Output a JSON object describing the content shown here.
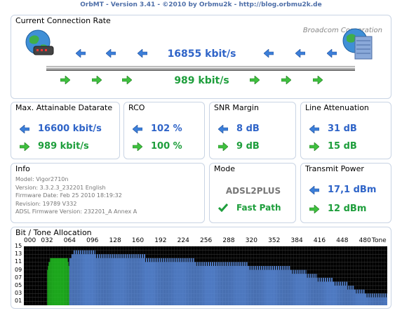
{
  "window": {
    "title": "OrbMT - Version 3.41 - ©2010 by Orbmu2k - http://blog.orbmu2k.de"
  },
  "connection": {
    "title": "Current Connection Rate",
    "isp": "Broadcom Corporation",
    "down_rate": "16855 kbit/s",
    "up_rate": "989 kbit/s"
  },
  "max_rate": {
    "title": "Max. Attainable Datarate",
    "down": "16600 kbit/s",
    "up": "989 kbit/s"
  },
  "rco": {
    "title": "RCO",
    "down": "102 %",
    "up": "100 %"
  },
  "snr": {
    "title": "SNR Margin",
    "down": "8 dB",
    "up": "9 dB"
  },
  "attenuation": {
    "title": "Line Attenuation",
    "down": "31 dB",
    "up": "15 dB"
  },
  "info": {
    "title": "Info",
    "lines": [
      "Model: Vigor2710n",
      "Version: 3.3.2.3_232201 English",
      "Firmware Date: Feb 25 2010 18:19:32",
      "Revision: 19789 V332",
      "ADSL Firmware Version: 232201_A   Annex A"
    ]
  },
  "mode": {
    "title": "Mode",
    "value": "ADSL2PLUS",
    "path": "Fast Path"
  },
  "power": {
    "title": "Transmit Power",
    "down": "17,1 dBm",
    "up": "12 dBm"
  },
  "bittone": {
    "title": "Bit / Tone Allocation",
    "x_ticks": [
      "000",
      "032",
      "064",
      "096",
      "128",
      "160",
      "192",
      "224",
      "256",
      "288",
      "320",
      "352",
      "384",
      "416",
      "448",
      "480",
      "Tone"
    ],
    "y_ticks": [
      "15",
      "13",
      "11",
      "09",
      "07",
      "05",
      "03",
      "01"
    ]
  },
  "chart_data": {
    "type": "bar",
    "title": "Bit / Tone Allocation",
    "xlabel": "Tone",
    "ylabel": "",
    "xlim": [
      0,
      511
    ],
    "ylim": [
      0,
      15
    ],
    "series": [
      {
        "name": "upstream",
        "color": "#22c322",
        "segments": [
          {
            "from": 33,
            "to": 63,
            "values": [
              9,
              10,
              11,
              11,
              12,
              12,
              12,
              12,
              12,
              12,
              12,
              12,
              12,
              12,
              12,
              12,
              12,
              12,
              12,
              12,
              12,
              12,
              12,
              12,
              12,
              12,
              12,
              12,
              12,
              11,
              10
            ]
          }
        ]
      },
      {
        "name": "downstream",
        "color": "#5b8de0",
        "segments": [
          {
            "from": 64,
            "to": 511,
            "profile": [
              [
                64,
                12
              ],
              [
                70,
                14
              ],
              [
                90,
                14
              ],
              [
                110,
                13
              ],
              [
                150,
                13
              ],
              [
                190,
                12
              ],
              [
                220,
                12
              ],
              [
                260,
                11
              ],
              [
                300,
                11
              ],
              [
                330,
                10
              ],
              [
                360,
                10
              ],
              [
                390,
                9
              ],
              [
                420,
                7
              ],
              [
                450,
                6
              ],
              [
                470,
                4
              ],
              [
                490,
                3
              ],
              [
                511,
                3
              ]
            ]
          }
        ]
      }
    ]
  }
}
